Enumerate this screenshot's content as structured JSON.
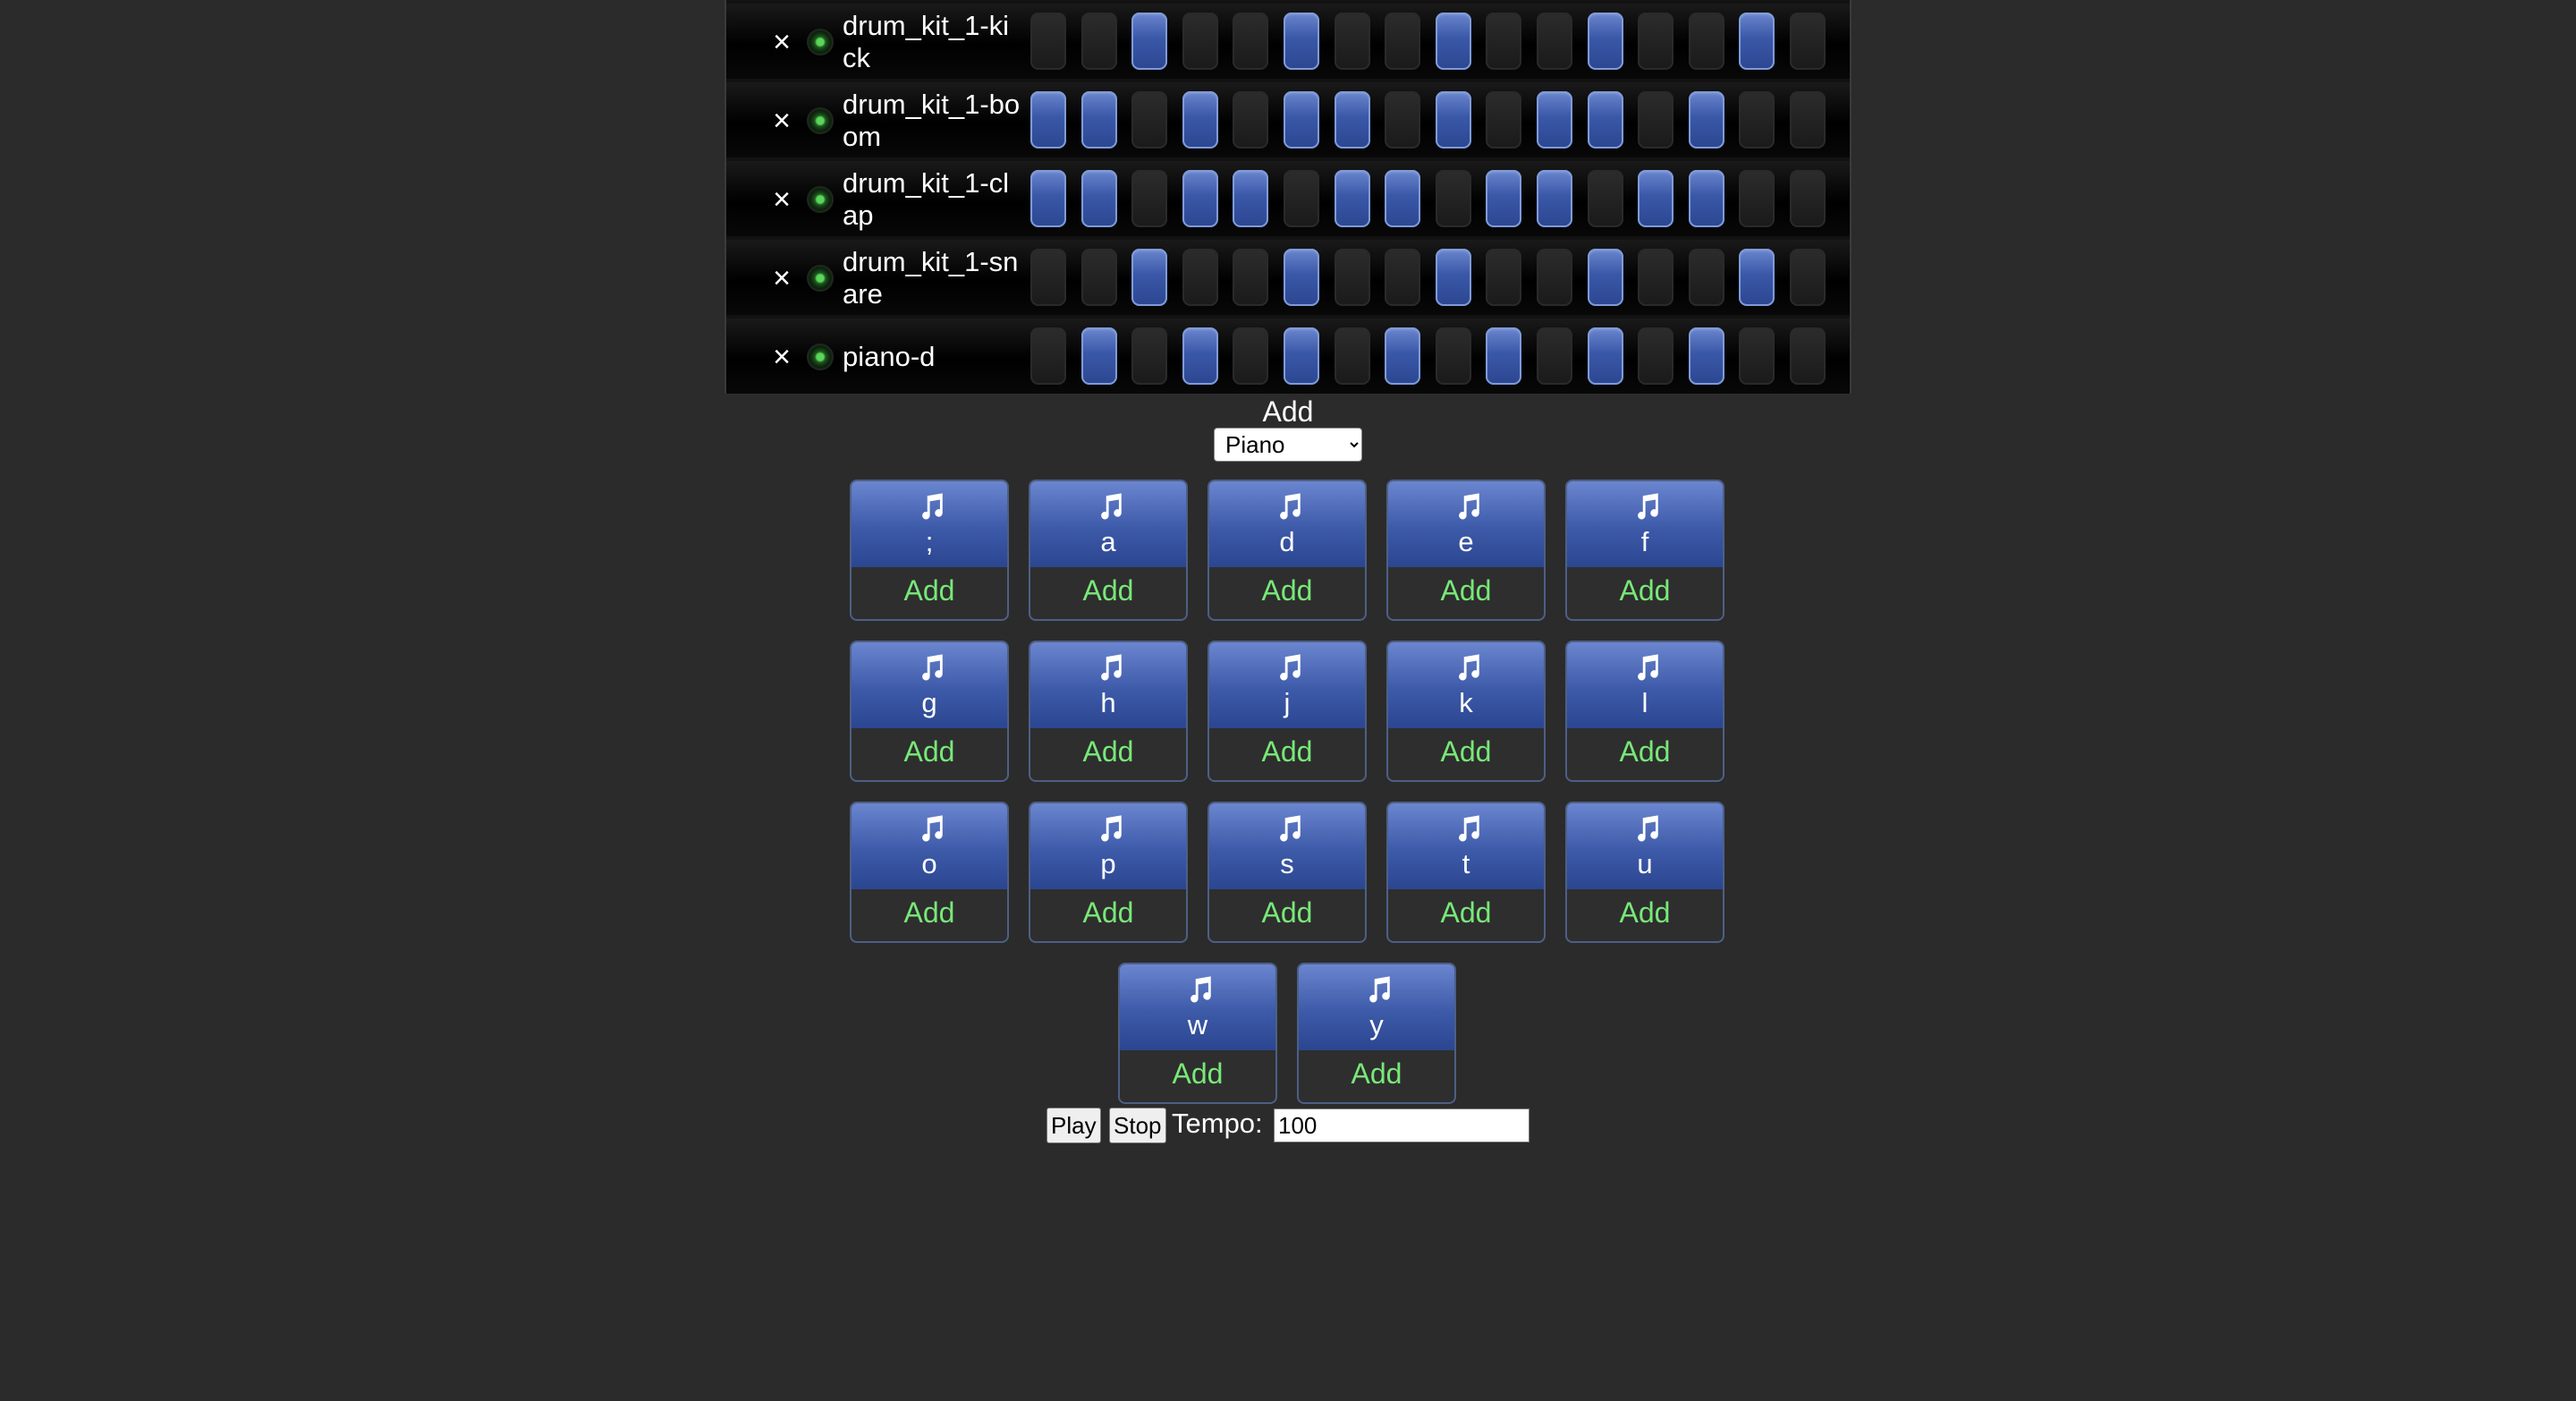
{
  "tracks": [
    {
      "name": "drum_kit_1-kick",
      "steps": [
        0,
        0,
        1,
        0,
        0,
        1,
        0,
        0,
        1,
        0,
        0,
        1,
        0,
        0,
        1,
        0
      ]
    },
    {
      "name": "drum_kit_1-boom",
      "steps": [
        1,
        1,
        0,
        1,
        0,
        1,
        1,
        0,
        1,
        0,
        1,
        1,
        0,
        1,
        0,
        0
      ]
    },
    {
      "name": "drum_kit_1-clap",
      "steps": [
        1,
        1,
        0,
        1,
        1,
        0,
        1,
        1,
        0,
        1,
        1,
        0,
        1,
        1,
        0,
        0
      ]
    },
    {
      "name": "drum_kit_1-snare",
      "steps": [
        0,
        0,
        1,
        0,
        0,
        1,
        0,
        0,
        1,
        0,
        0,
        1,
        0,
        0,
        1,
        0
      ]
    },
    {
      "name": "piano-d",
      "steps": [
        0,
        1,
        0,
        1,
        0,
        1,
        0,
        1,
        0,
        1,
        0,
        1,
        0,
        1,
        0,
        0
      ]
    }
  ],
  "track_controls": {
    "remove_glyph": "×"
  },
  "add_section": {
    "label": "Add",
    "selected_instrument": "Piano",
    "instrument_options": [
      "Piano"
    ]
  },
  "samples": [
    {
      "key": ";",
      "add_label": "Add"
    },
    {
      "key": "a",
      "add_label": "Add"
    },
    {
      "key": "d",
      "add_label": "Add"
    },
    {
      "key": "e",
      "add_label": "Add"
    },
    {
      "key": "f",
      "add_label": "Add"
    },
    {
      "key": "g",
      "add_label": "Add"
    },
    {
      "key": "h",
      "add_label": "Add"
    },
    {
      "key": "j",
      "add_label": "Add"
    },
    {
      "key": "k",
      "add_label": "Add"
    },
    {
      "key": "l",
      "add_label": "Add"
    },
    {
      "key": "o",
      "add_label": "Add"
    },
    {
      "key": "p",
      "add_label": "Add"
    },
    {
      "key": "s",
      "add_label": "Add"
    },
    {
      "key": "t",
      "add_label": "Add"
    },
    {
      "key": "u",
      "add_label": "Add"
    },
    {
      "key": "w",
      "add_label": "Add"
    },
    {
      "key": "y",
      "add_label": "Add"
    }
  ],
  "sample_icon": "music-note-icon",
  "controls": {
    "play_label": "Play",
    "stop_label": "Stop",
    "tempo_label": "Tempo:",
    "tempo_value": "100"
  },
  "colors": {
    "background": "#2b2b2b",
    "step_on": "#3a58a8",
    "step_off": "#222222",
    "add_text": "#78e878",
    "led": "#5ad65a"
  }
}
